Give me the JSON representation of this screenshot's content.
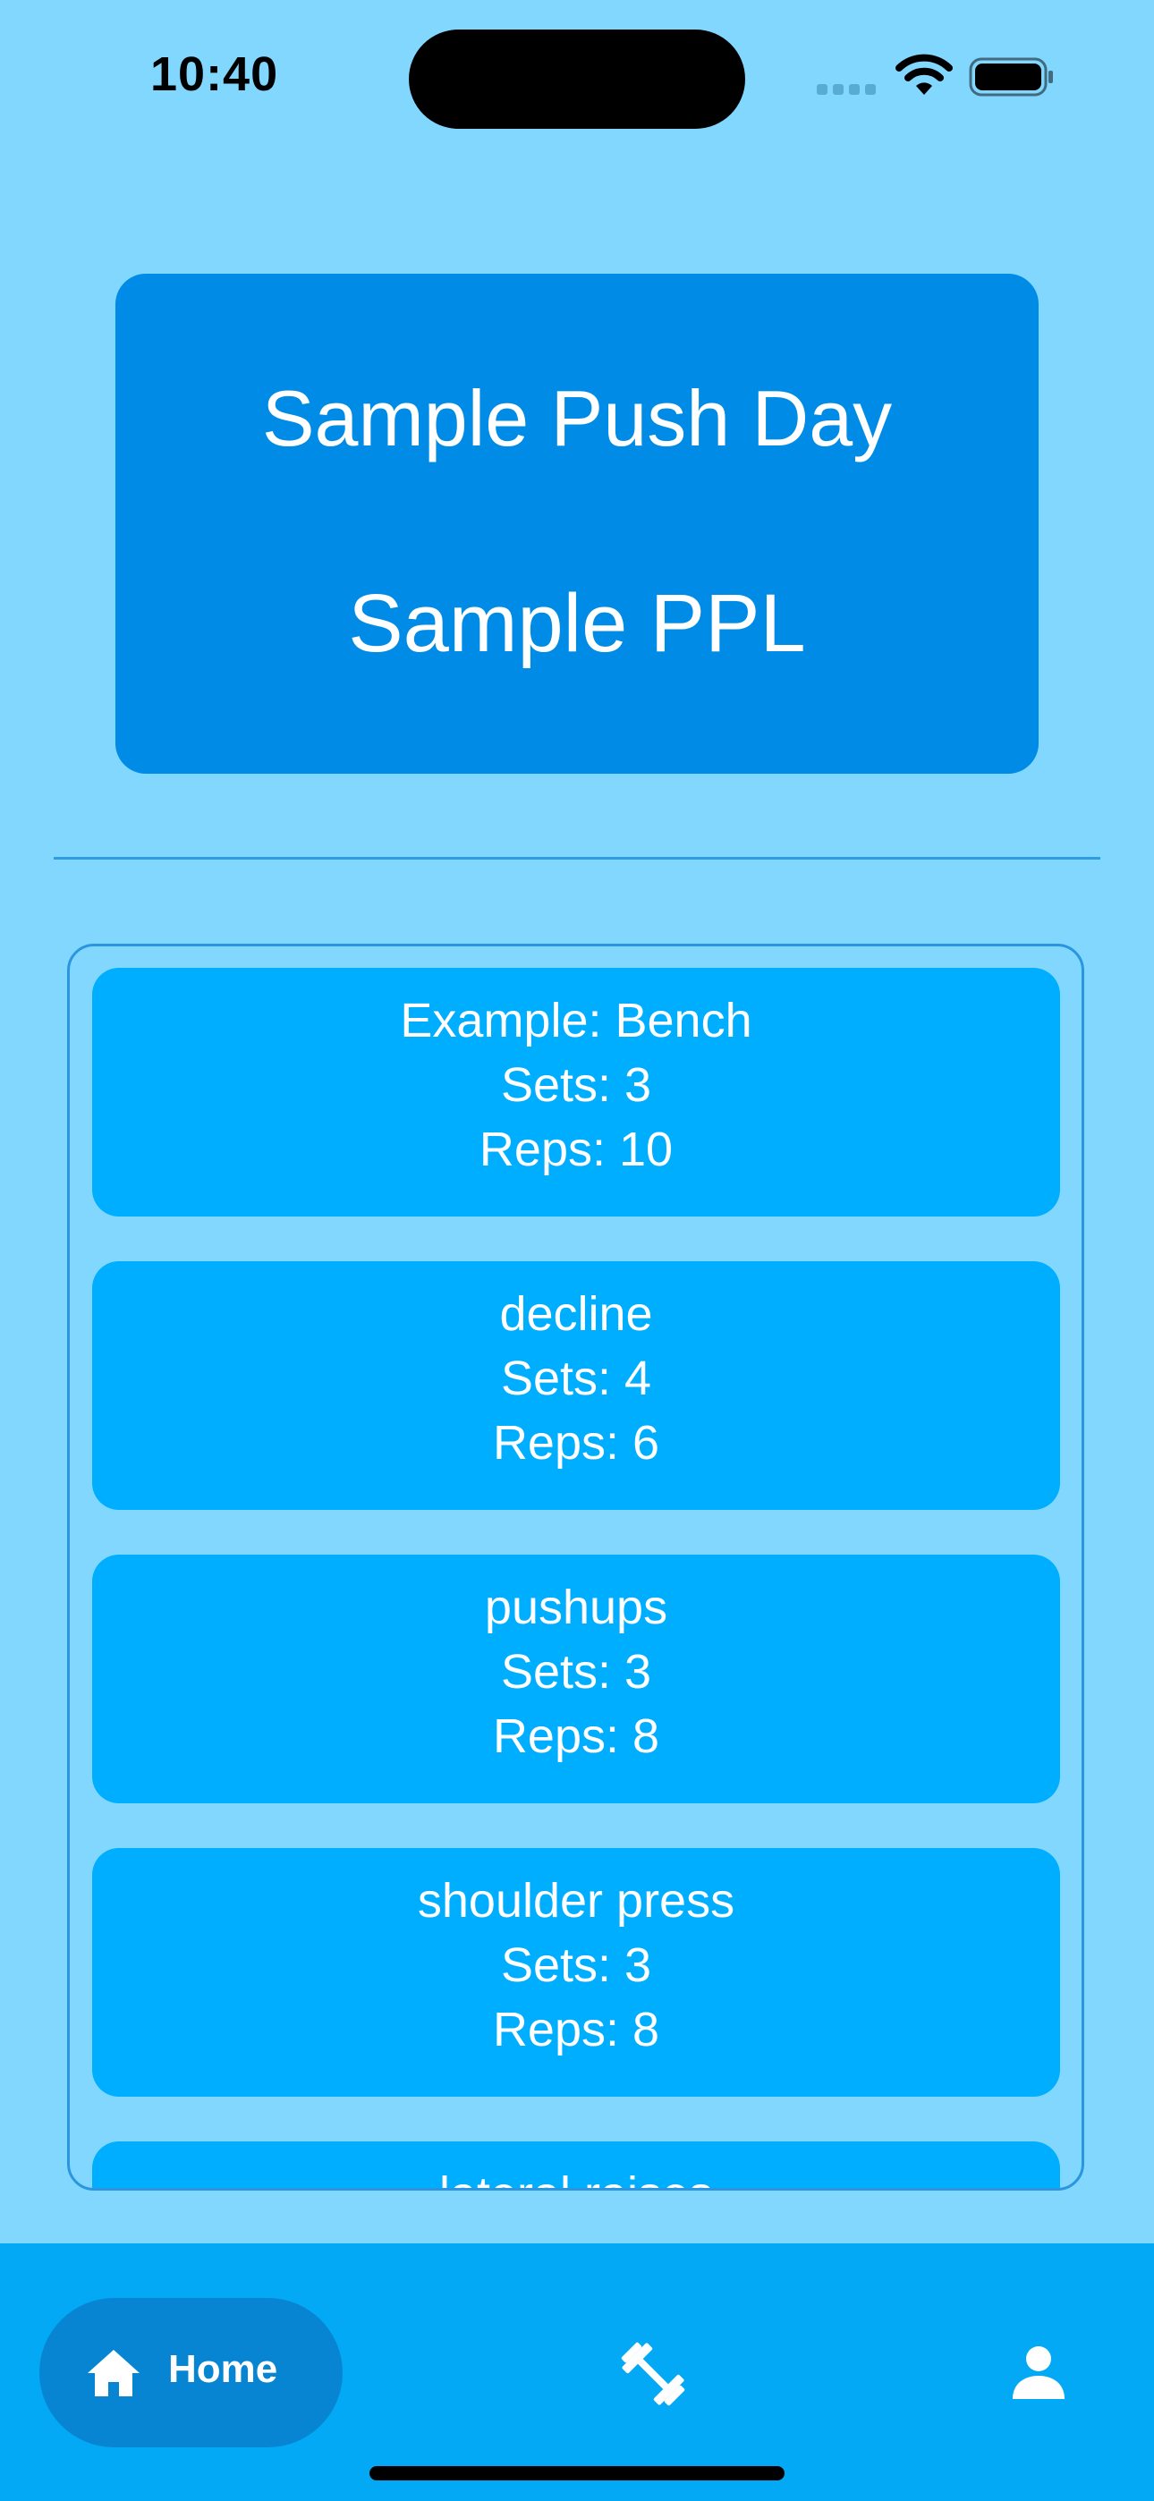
{
  "status_bar": {
    "time": "10:40",
    "icons": [
      "cellular-signal-icon",
      "wifi-icon",
      "battery-icon"
    ]
  },
  "workout": {
    "title": "Sample Push Day",
    "program": "Sample PPL"
  },
  "exercises": [
    {
      "name": "Example: Bench",
      "sets": "Sets: 3",
      "reps": "Reps: 10"
    },
    {
      "name": "decline",
      "sets": "Sets: 4",
      "reps": "Reps: 6"
    },
    {
      "name": "pushups",
      "sets": "Sets: 3",
      "reps": "Reps: 8"
    },
    {
      "name": "shoulder press",
      "sets": "Sets: 3",
      "reps": "Reps: 8"
    },
    {
      "name": "lateral raises"
    }
  ],
  "nav": {
    "home_label": "Home",
    "icons": [
      "home-icon",
      "dumbbell-icon",
      "person-icon"
    ]
  },
  "colors": {
    "background": "#82d7ff",
    "header_card": "#008ce6",
    "exercise_card": "#00aeff",
    "nav_bar": "#03a9f4",
    "nav_active": "#0785d2"
  }
}
